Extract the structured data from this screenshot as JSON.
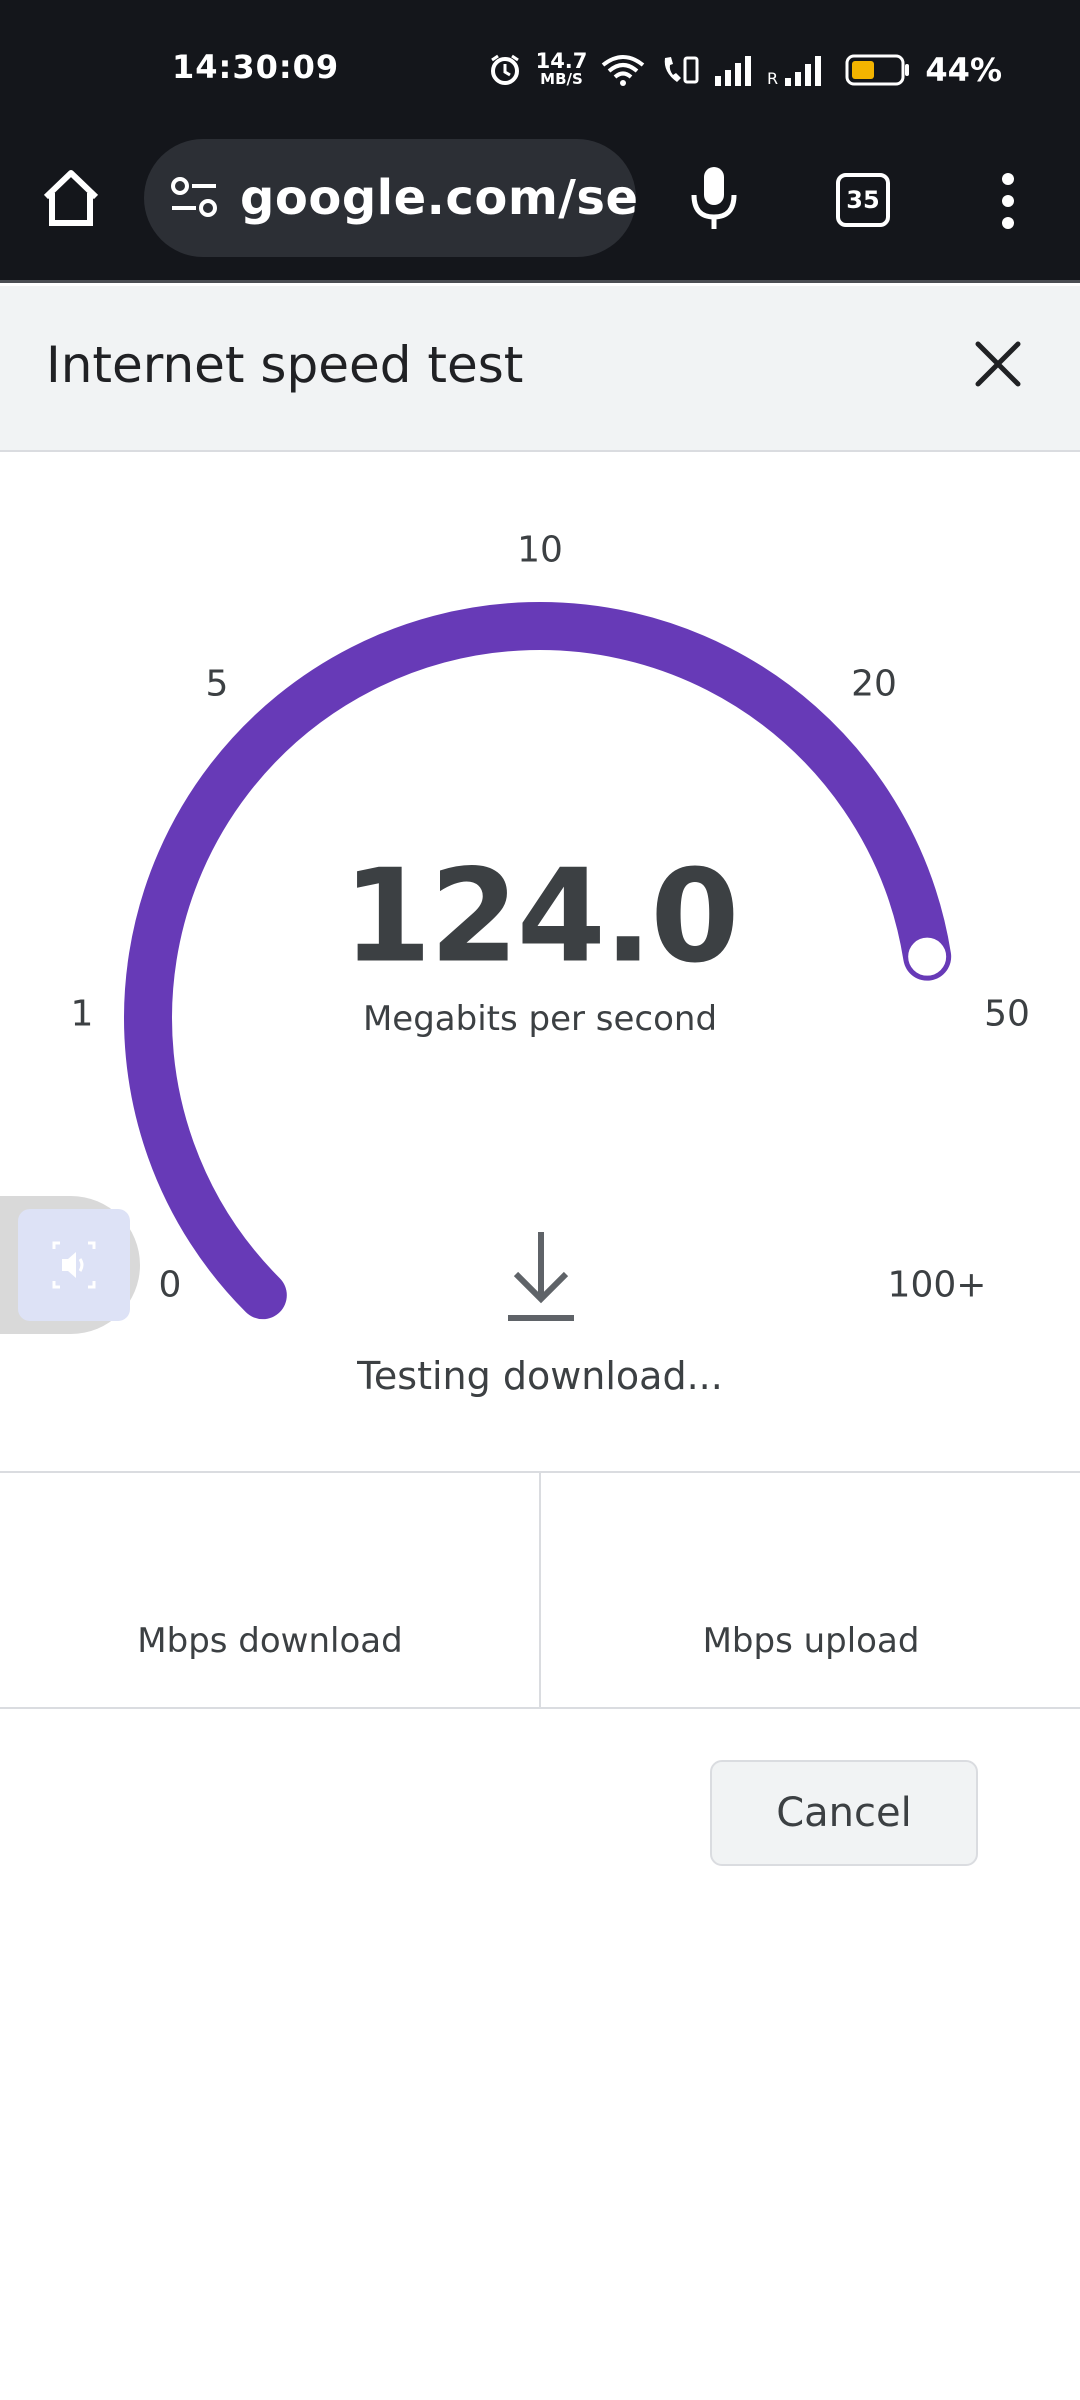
{
  "status_bar": {
    "time": "14:30:09",
    "net_speed_value": "14.7",
    "net_speed_unit": "MB/S",
    "battery_percent": "44%",
    "icons": [
      "alarm-icon",
      "wifi-icon",
      "volte-call-icon",
      "signal-icon",
      "roaming-signal-icon",
      "battery-icon"
    ]
  },
  "browser": {
    "url": "google.com/search",
    "tab_count": "35",
    "icons": [
      "home-icon",
      "site-settings-icon",
      "microphone-icon",
      "tab-switcher-icon",
      "more-options-icon"
    ]
  },
  "card": {
    "title": "Internet speed test",
    "close_icon": "close-icon"
  },
  "gauge": {
    "tick_labels": [
      "0",
      "1",
      "5",
      "10",
      "20",
      "50",
      "100+"
    ],
    "current_value": "124.0",
    "unit_label": "Megabits per second",
    "status_text": "Testing download...",
    "fill_fraction": 1.0,
    "arc_color": "#673ab7",
    "needle_color": "#ffffff"
  },
  "results": {
    "download_label": "Mbps download",
    "upload_label": "Mbps upload"
  },
  "actions": {
    "cancel_label": "Cancel"
  },
  "floating": {
    "icon": "volume-icon"
  }
}
